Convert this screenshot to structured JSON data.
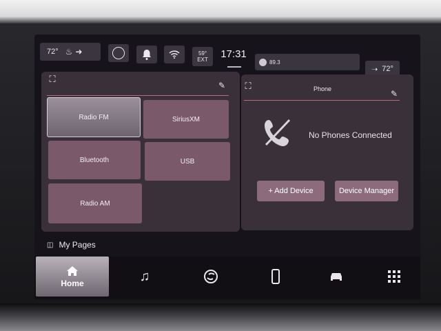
{
  "status_bar": {
    "outside_temp": "72°",
    "outside_temp_right": "72°",
    "ext_temp": "59°",
    "ext_label": "EXT",
    "time": "17:31",
    "radio_station": "89.3"
  },
  "media_panel": {
    "sources": [
      "Radio FM",
      "SiriusXM",
      "Bluetooth",
      "USB",
      "Radio AM"
    ],
    "active_source": "Radio FM"
  },
  "phone_panel": {
    "title": "Phone",
    "status": "No Phones Connected",
    "add_device": "+ Add Device",
    "device_manager": "Device Manager"
  },
  "my_pages": "My Pages",
  "nav": {
    "home_label": "Home",
    "items": [
      "home-icon",
      "music-note-icon",
      "sync-icon",
      "phone-icon",
      "car-icon",
      "apps-grid-icon"
    ]
  },
  "colors": {
    "panel_bg": "#3a3039",
    "tile_bg": "#7a5a6a",
    "accent_line": "#b86c7b",
    "screen_bg": "#17131a"
  }
}
